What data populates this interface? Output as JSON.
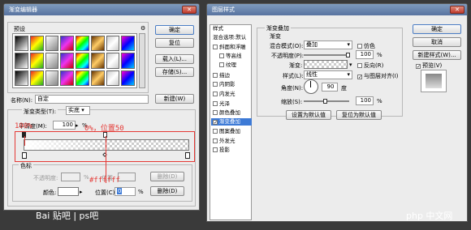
{
  "gradient_editor": {
    "title": "渐变编辑器",
    "presets_label": "预设",
    "buttons": {
      "ok": "确定",
      "reset": "复位",
      "load": "载入(L)...",
      "save": "存储(S)...",
      "new": "新建(W)"
    },
    "name_label": "名称(N):",
    "name_value": "自定",
    "gradient_type_label": "渐变类型(T):",
    "gradient_type_value": "实底",
    "smoothness_label": "平滑度(M):",
    "smoothness_value": "100",
    "percent": "%",
    "stops_label": "色标",
    "opacity_label": "不透明度:",
    "opacity_location_label": "位置:",
    "opacity_delete": "删除(D)",
    "color_label": "颜色:",
    "color_location_label": "位置(C):",
    "color_location_value": "0",
    "color_delete": "删除(D)"
  },
  "annotations": {
    "left": "100%",
    "right": "0%，位置50",
    "hex": "#ffffff"
  },
  "layer_style": {
    "title": "图层样式",
    "styles_header": "样式",
    "blend_options": "混合选项:默认",
    "items": [
      {
        "label": "斜面和浮雕",
        "checked": false
      },
      {
        "label": "等高线",
        "checked": false
      },
      {
        "label": "纹理",
        "checked": false
      },
      {
        "label": "描边",
        "checked": false
      },
      {
        "label": "内阴影",
        "checked": false
      },
      {
        "label": "内发光",
        "checked": false
      },
      {
        "label": "光泽",
        "checked": false
      },
      {
        "label": "颜色叠加",
        "checked": false
      },
      {
        "label": "渐变叠加",
        "checked": true
      },
      {
        "label": "图案叠加",
        "checked": false
      },
      {
        "label": "外发光",
        "checked": false
      },
      {
        "label": "投影",
        "checked": false
      }
    ],
    "panel_title": "渐变叠加",
    "panel_sub": "渐变",
    "blend_mode_label": "混合模式(O):",
    "blend_mode_value": "叠加",
    "dither_label": "仿色",
    "opacity_label": "不透明度(P):",
    "opacity_value": "100",
    "gradient_label": "渐变:",
    "reverse_label": "反向(R)",
    "style_label": "样式(L):",
    "style_value": "线性",
    "align_label": "与图层对齐(I)",
    "angle_label": "角度(N):",
    "angle_value": "90",
    "angle_unit": "度",
    "scale_label": "缩放(S):",
    "scale_value": "100",
    "percent": "%",
    "set_default": "设置为默认值",
    "reset_default": "复位为默认值",
    "buttons": {
      "ok": "确定",
      "cancel": "取消",
      "new_style": "新建样式(W)...",
      "preview": "预览(V)"
    }
  },
  "watermarks": {
    "baidu": "Bai 贴吧 | ps吧",
    "php": "php 中文网"
  }
}
